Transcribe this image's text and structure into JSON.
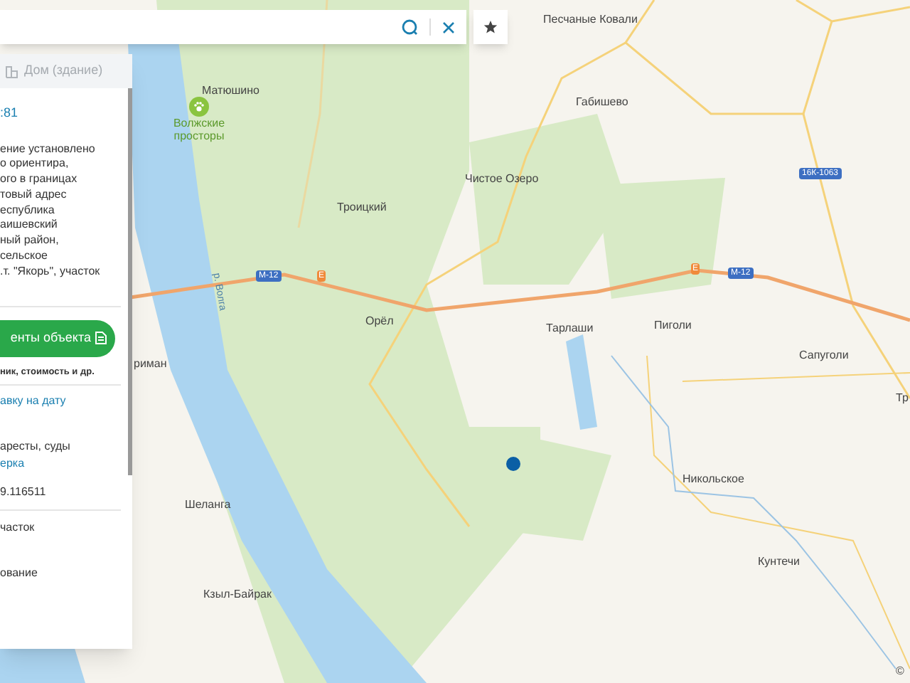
{
  "panel": {
    "header": "Дом (здание)",
    "number_suffix": ":81",
    "description_lines": [
      "ение установлено",
      "о ориентира,",
      "ого в границах",
      "товый адрес",
      "еспублика",
      "аишевский",
      "ный район,",
      "сельское",
      ".т. \"Якорь\", участок"
    ],
    "documents_button": "енты объекта",
    "documents_note": "ник, стоимость и др.",
    "date_link": "авку на дату",
    "arrests_text": "аресты, суды",
    "check_link": "ерка",
    "value": "9.116511",
    "land_text": "часток",
    "usage_text": "ование"
  },
  "map": {
    "labels": [
      {
        "kind": "place",
        "text": "Песчаные Ковали"
      },
      {
        "kind": "place",
        "text": "Матюшино"
      },
      {
        "kind": "poi",
        "text": "Волжские просторы"
      },
      {
        "kind": "place",
        "text": "Габишево"
      },
      {
        "kind": "place",
        "text": "Чистое Озеро"
      },
      {
        "kind": "place",
        "text": "Троицкий"
      },
      {
        "kind": "river",
        "text": "р. Волга"
      },
      {
        "kind": "place",
        "text": "Орёл"
      },
      {
        "kind": "place",
        "text": "Тарлаши"
      },
      {
        "kind": "place",
        "text": "Пиголи"
      },
      {
        "kind": "place",
        "text": "риман"
      },
      {
        "kind": "place",
        "text": "Сапуголи"
      },
      {
        "kind": "place",
        "text": "Тр"
      },
      {
        "kind": "place",
        "text": "Никольское"
      },
      {
        "kind": "place",
        "text": "Шеланга"
      },
      {
        "kind": "place",
        "text": "Кунтечи"
      },
      {
        "kind": "place",
        "text": "Кзыл-Байрак"
      }
    ],
    "shields": [
      {
        "kind": "route",
        "text": "16К-1063"
      },
      {
        "kind": "route",
        "text": "М-12"
      },
      {
        "kind": "exit",
        "text": "E"
      },
      {
        "kind": "exit",
        "text": "E"
      },
      {
        "kind": "route",
        "text": "М-12"
      }
    ],
    "copyright": "©"
  }
}
